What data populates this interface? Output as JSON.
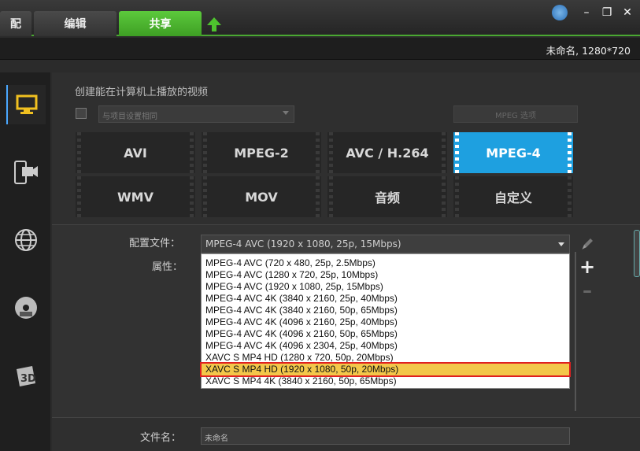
{
  "tabs": {
    "prev": "配",
    "edit": "编辑",
    "share": "共享"
  },
  "project_info": "未命名, 1280*720",
  "section_title": "创建能在计算机上播放的视频",
  "preset_select": {
    "value": "与项目设置相同"
  },
  "mpeg_settings_label": "MPEG 选项",
  "formats": [
    "AVI",
    "MPEG-2",
    "AVC / H.264",
    "MPEG-4",
    "WMV",
    "MOV",
    "音频",
    "自定义"
  ],
  "active_format": "MPEG-4",
  "labels": {
    "profile": "配置文件：",
    "properties": "属性：",
    "filename": "文件名："
  },
  "profile_select": {
    "value": "MPEG-4 AVC (1920 x 1080, 25p, 15Mbps)"
  },
  "profile_options": [
    "MPEG-4 AVC (720 x 480, 25p, 2.5Mbps)",
    "MPEG-4 AVC (1280 x 720, 25p, 10Mbps)",
    "MPEG-4 AVC (1920 x 1080, 25p, 15Mbps)",
    "MPEG-4 AVC 4K (3840 x 2160, 25p, 40Mbps)",
    "MPEG-4 AVC 4K (3840 x 2160, 50p, 65Mbps)",
    "MPEG-4 AVC 4K (4096 x 2160, 25p, 40Mbps)",
    "MPEG-4 AVC 4K (4096 x 2160, 50p, 65Mbps)",
    "MPEG-4 AVC 4K (4096 x 2304, 25p, 40Mbps)",
    "XAVC S MP4 HD (1280 x 720, 50p, 20Mbps)",
    "XAVC S MP4 HD (1920 x 1080, 50p, 20Mbps)",
    "XAVC S MP4 4K (3840 x 2160, 50p, 65Mbps)"
  ],
  "highlighted_option": "XAVC S MP4 HD (1920 x 1080, 50p, 20Mbps)",
  "filename_value": "未命名",
  "colors": {
    "accent_green": "#4aa832",
    "active_blue": "#1ea0e0",
    "highlight": "#f3c74a",
    "highlight_border": "#e02020"
  }
}
